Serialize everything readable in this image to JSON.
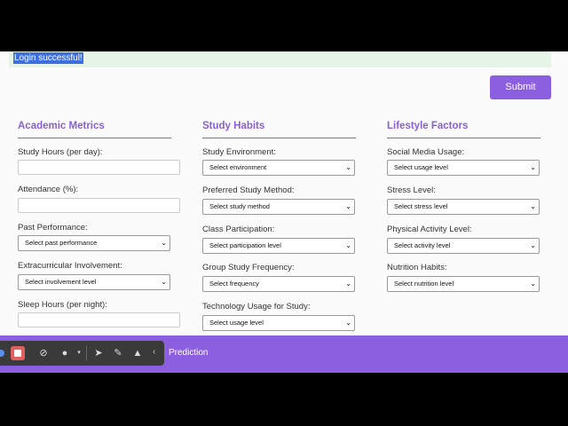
{
  "alert": {
    "text": "Login successful!"
  },
  "submit_label": "Submit",
  "sections": {
    "academic": {
      "title": "Academic Metrics",
      "study_hours_label": "Study Hours (per day):",
      "attendance_label": "Attendance (%):",
      "past_performance_label": "Past Performance:",
      "past_performance_value": "Select past performance",
      "extracurricular_label": "Extracurricular Involvement:",
      "extracurricular_value": "Select involvement level",
      "sleep_label": "Sleep Hours (per night):"
    },
    "study": {
      "title": "Study Habits",
      "environment_label": "Study Environment:",
      "environment_value": "Select environment",
      "method_label": "Preferred Study Method:",
      "method_value": "Select study method",
      "participation_label": "Class Participation:",
      "participation_value": "Select participation level",
      "group_label": "Group Study Frequency:",
      "group_value": "Select frequency",
      "tech_label": "Technology Usage for Study:",
      "tech_value": "Select usage level"
    },
    "lifestyle": {
      "title": "Lifestyle Factors",
      "social_label": "Social Media Usage:",
      "social_value": "Select usage level",
      "stress_label": "Stress Level:",
      "stress_value": "Select stress level",
      "activity_label": "Physical Activity Level:",
      "activity_value": "Select activity level",
      "nutrition_label": "Nutrition Habits:",
      "nutrition_value": "Select nutrition level"
    }
  },
  "footer": {
    "text": "Prediction"
  },
  "toolbar": {
    "icons": [
      "stop-icon",
      "camera-off-icon",
      "microphone-icon",
      "pointer-icon",
      "pen-icon",
      "broom-icon",
      "chevron-left-icon"
    ]
  },
  "colors": {
    "accent": "#8c5fe0",
    "alert_bg": "#e6f4e7",
    "heading": "#8a5fd6"
  }
}
